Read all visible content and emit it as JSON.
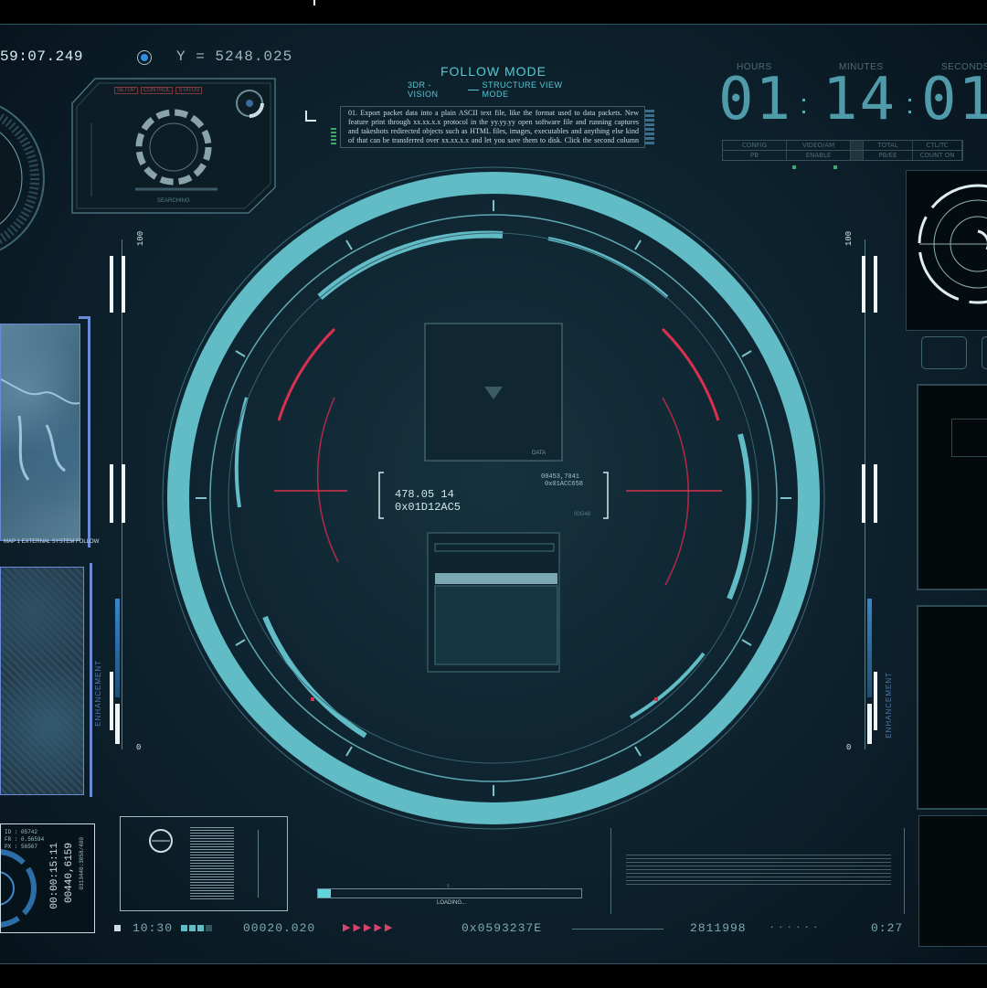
{
  "coordinates": {
    "x_readout": "59:07.249",
    "y_readout": "Y = 5248.025"
  },
  "header": {
    "title": "FOLLOW MODE",
    "subtitle_left": "3DR - VISION",
    "subtitle_right": "STRUCTURE VIEW MODE"
  },
  "info_text": "01. Export packet data into a plain ASCII text file, like the format used to data packets. New feature print through xx.xx.x.x protocol in the yy.yy.yy open software file and running captures and takeshots redirected objects such as HTML files, images, executables and anything else kind of that can be transferred over xx.xx.x.x and let you save them to disk. Click the second column and select a data type. Repeat for every column.",
  "top_left_panel": {
    "tabs": [
      "SETUP",
      "CONTROL",
      "STATUS"
    ],
    "status": "SEARCHING"
  },
  "clock": {
    "labels": [
      "HOURS",
      "MINUTES",
      "SECONDS"
    ],
    "hours": "01",
    "minutes": "14",
    "seconds": "01",
    "status_top": [
      "CONFIG",
      "VIDEO/AM",
      "",
      "TOTAL",
      "CTL/TC"
    ],
    "status_bottom": [
      "PB",
      "ENABLE",
      "",
      "PB/EE",
      "COUNT ON"
    ]
  },
  "scales": {
    "left_max": "100",
    "left_min": "0",
    "right_max": "100",
    "right_min": "0",
    "left_label": "ENHANCEMENT",
    "right_label": "ENHANCEMENT"
  },
  "center": {
    "readout_line1": "478.05    14",
    "readout_line2": "0x01D12AC5",
    "readout_right_1": "00453,7041",
    "readout_right_2": "0x01ACC658",
    "data_label": "DATA",
    "small_code": "00G48"
  },
  "left_map_caption": "MAP 1 EXTERNAL SYSTEM FOLLOW",
  "bottom_left_panel": {
    "lines": [
      "ID : 05742",
      "FR : 0.56594",
      "PX : 56567"
    ],
    "value_a": "00:00:15:11",
    "value_b": "00440,6159",
    "code": "0313440:3058/400"
  },
  "loading": {
    "label": "LOADING...",
    "number": "5",
    "progress": 0.05
  },
  "footer": {
    "time": "10:30",
    "counter": "00020.020",
    "hex": "0x0593237E",
    "serial": "2811998",
    "right_time": "0:27"
  },
  "colors": {
    "accent": "#5bb8c4",
    "ring": "#62bcc6",
    "alert": "#d8314f",
    "scale_blue": "#3a86c8"
  }
}
